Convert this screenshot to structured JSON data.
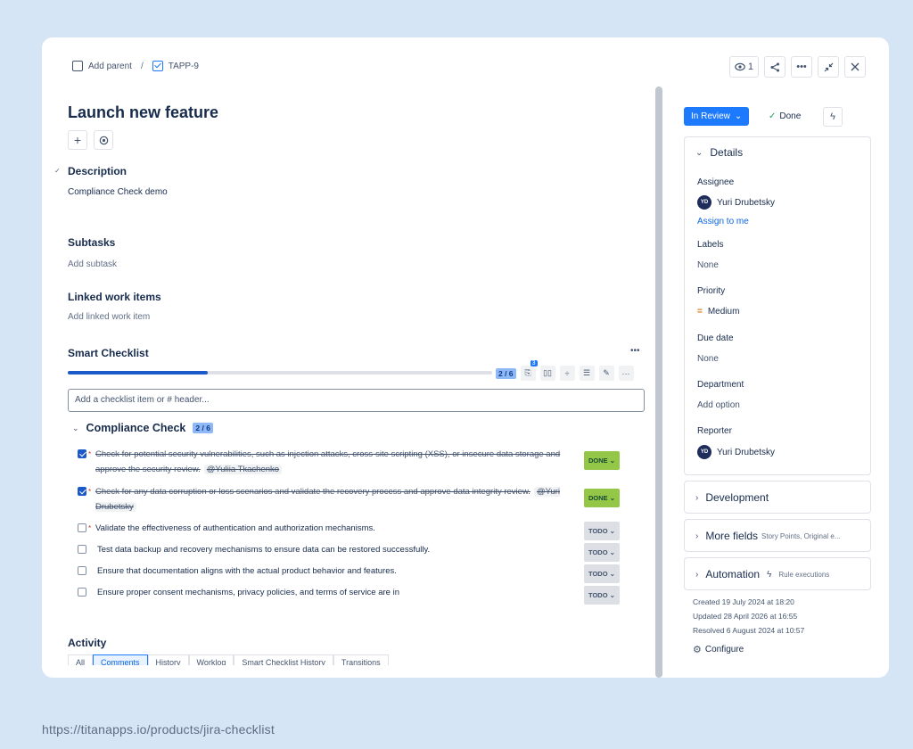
{
  "breadcrumb": {
    "parent": "Add parent",
    "separator": "/",
    "key": "TAPP-9"
  },
  "toolbar": {
    "watchers": "1"
  },
  "issue": {
    "title": "Launch new feature"
  },
  "description": {
    "heading": "Description",
    "text": "Compliance Check demo"
  },
  "subtasks": {
    "heading": "Subtasks",
    "placeholder": "Add subtask"
  },
  "linked": {
    "heading": "Linked work items",
    "placeholder": "Add linked work item"
  },
  "checklist": {
    "heading": "Smart Checklist",
    "progress_label": "2 / 6",
    "progress_fraction": 0.33,
    "tool_badge": "3",
    "input_placeholder": "Add a checklist item or # header...",
    "group": {
      "name": "Compliance Check",
      "count": "2 / 6"
    },
    "items": [
      {
        "text": "Check for potential security vulnerabilities, such as injection attacks, cross-site scripting (XSS), or insecure data storage and approve the security review.",
        "mention": "@Yuliia Tkachenko",
        "status": "DONE",
        "checked": true,
        "required": true
      },
      {
        "text": "Check for any data corruption or loss scenarios and validate the recovery process and approve data integrity review.",
        "mention": "@Yuri Drubetsky",
        "status": "DONE",
        "checked": true,
        "required": true
      },
      {
        "text": "Validate the effectiveness of authentication and authorization mechanisms.",
        "mention": "",
        "status": "TODO",
        "checked": false,
        "required": true
      },
      {
        "text": "Test data backup and recovery mechanisms to ensure data can be restored successfully.",
        "mention": "",
        "status": "TODO",
        "checked": false,
        "required": false
      },
      {
        "text": "Ensure that documentation aligns with the actual product behavior and features.",
        "mention": "",
        "status": "TODO",
        "checked": false,
        "required": false
      },
      {
        "text": "Ensure proper consent mechanisms, privacy policies, and terms of service are in",
        "mention": "",
        "status": "TODO",
        "checked": false,
        "required": false
      }
    ]
  },
  "activity": {
    "heading": "Activity",
    "tabs": [
      "All",
      "Comments",
      "History",
      "Worklog",
      "Smart Checklist History",
      "Transitions"
    ]
  },
  "status_button": {
    "label": "In Review"
  },
  "done_button": {
    "label": "Done"
  },
  "details": {
    "heading": "Details",
    "assignee_label": "Assignee",
    "assignee_initials": "YD",
    "assignee_name": "Yuri Drubetsky",
    "assign_to_me": "Assign to me",
    "labels_label": "Labels",
    "labels_value": "None",
    "priority_label": "Priority",
    "priority_value": "Medium",
    "due_label": "Due date",
    "due_value": "None",
    "department_label": "Department",
    "department_value": "Add option",
    "reporter_label": "Reporter",
    "reporter_initials": "YD",
    "reporter_name": "Yuri Drubetsky"
  },
  "development": {
    "heading": "Development"
  },
  "more_fields": {
    "heading": "More fields",
    "hint": "Story Points, Original e..."
  },
  "automation": {
    "heading": "Automation",
    "hint": "Rule executions"
  },
  "meta": {
    "created": "Created 19 July 2024 at 18:20",
    "updated": "Updated 28 April 2026 at 16:55",
    "resolved": "Resolved 6 August 2024 at 10:57",
    "configure": "Configure"
  },
  "footer": {
    "url": "https://titanapps.io/products/jira-checklist"
  },
  "colors": {
    "accent": "#1d7afc",
    "done": "#94c748",
    "background": "#d6e5f6"
  }
}
